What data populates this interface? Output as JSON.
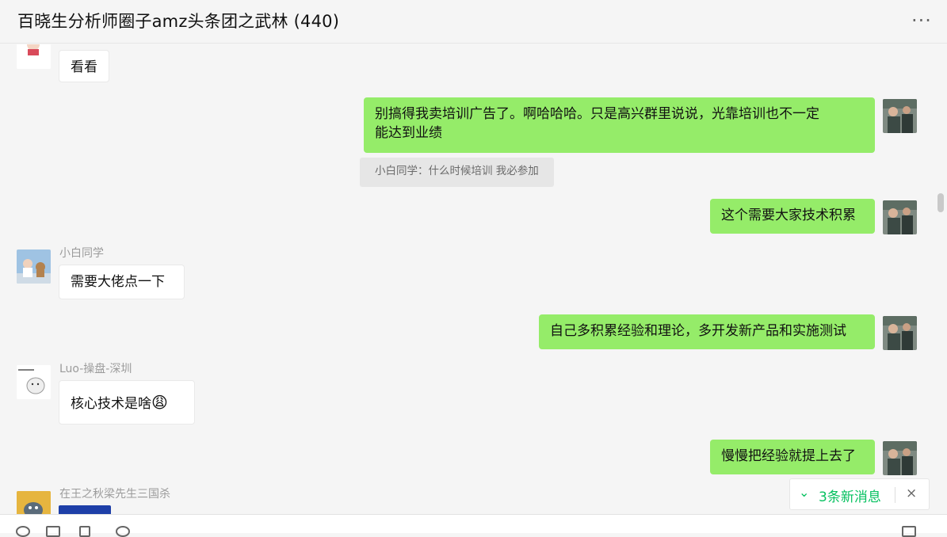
{
  "chat": {
    "title": "百晓生分析师圈子amz头条团之武林 (440)",
    "more_icon": "more-icon"
  },
  "messages": [
    {
      "side": "in",
      "text": "看看"
    },
    {
      "side": "out",
      "text_line1": "别搞得我卖培训广告了。啊哈哈哈。只是高兴群里说说，光靠培训也不一定",
      "text_line2": "能达到业绩"
    },
    {
      "quote": "小白同学：什么时候培训  我必参加"
    },
    {
      "side": "out",
      "text": "这个需要大家技术积累"
    },
    {
      "side": "in",
      "sender": "小白同学",
      "text": "需要大佬点一下"
    },
    {
      "side": "out",
      "text": "自己多积累经验和理论，多开发新产品和实施测试"
    },
    {
      "side": "in",
      "sender": "Luo-操盘-深圳",
      "text": "核心技术是啥",
      "emoji": "😩"
    },
    {
      "side": "out",
      "text": "慢慢把经验就提上去了"
    },
    {
      "side": "in",
      "sender": "在王之秋梁先生三国杀"
    }
  ],
  "new_messages": {
    "label": "3条新消息",
    "chevron_icon": "double-chevron-down-icon",
    "close_label": "×"
  },
  "colors": {
    "outgoing_bubble": "#95ec69",
    "incoming_bubble": "#ffffff",
    "accent_green": "#07c160"
  }
}
